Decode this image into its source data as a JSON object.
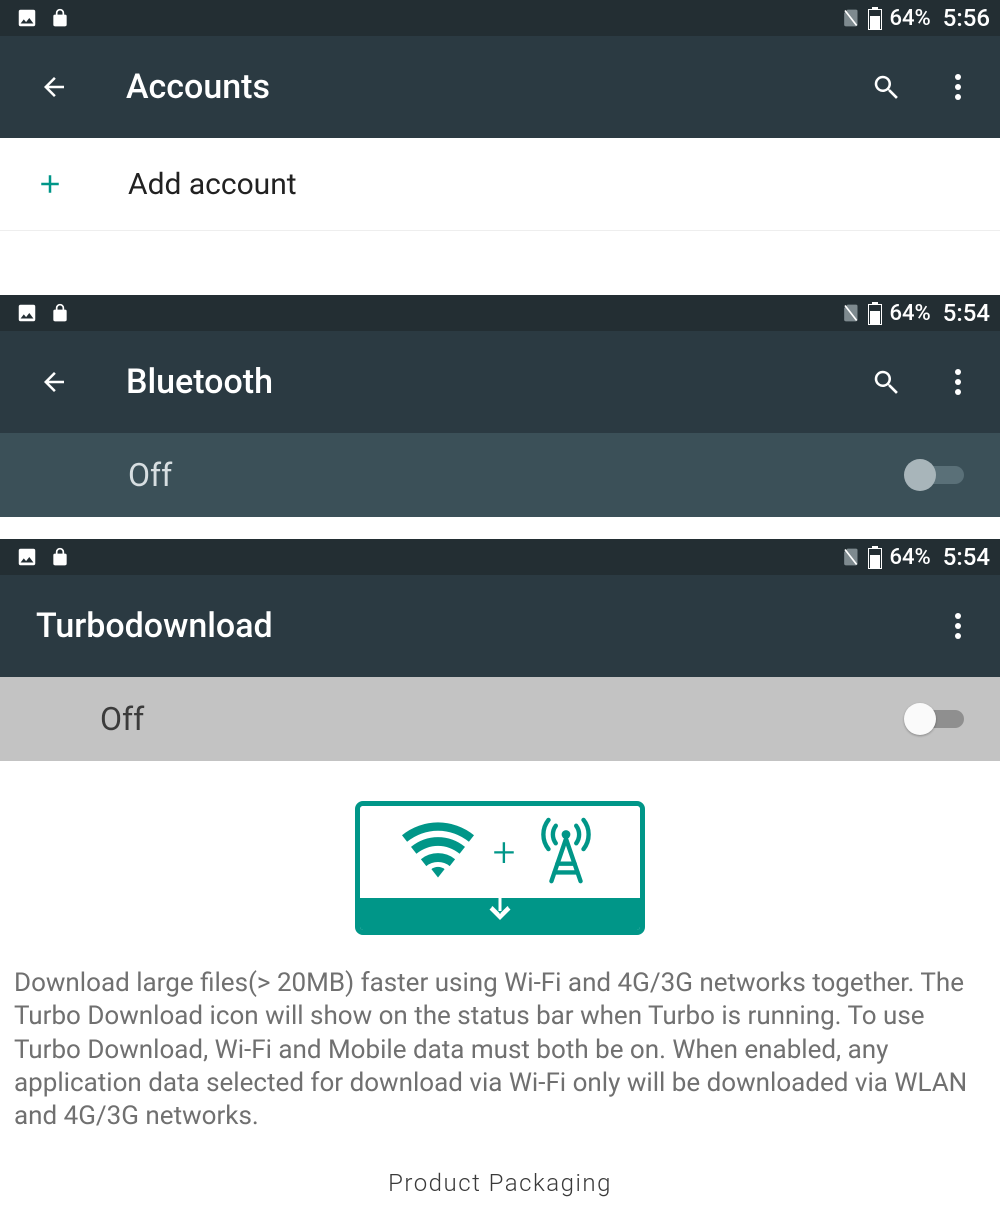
{
  "accent": "#009688",
  "panels": {
    "accounts": {
      "status": {
        "battery": "64%",
        "time": "5:56"
      },
      "title": "Accounts",
      "row": {
        "label": "Add account"
      }
    },
    "bluetooth": {
      "status": {
        "battery": "64%",
        "time": "5:54"
      },
      "title": "Bluetooth",
      "state_label": "Off",
      "switch_on": false
    },
    "turbo": {
      "status": {
        "battery": "64%",
        "time": "5:54"
      },
      "title": "Turbodownload",
      "state_label": "Off",
      "switch_on": false,
      "illustration_plus": "+",
      "description": "Download large files(> 20MB) faster using Wi-Fi and 4G/3G networks together. The Turbo Download icon will show on the status bar when Turbo is running. To use Turbo Download, Wi-Fi and Mobile data must both be on. When enabled, any application data selected for download via Wi-Fi only will be downloaded via WLAN and 4G/3G networks."
    }
  },
  "caption": "Product Packaging"
}
